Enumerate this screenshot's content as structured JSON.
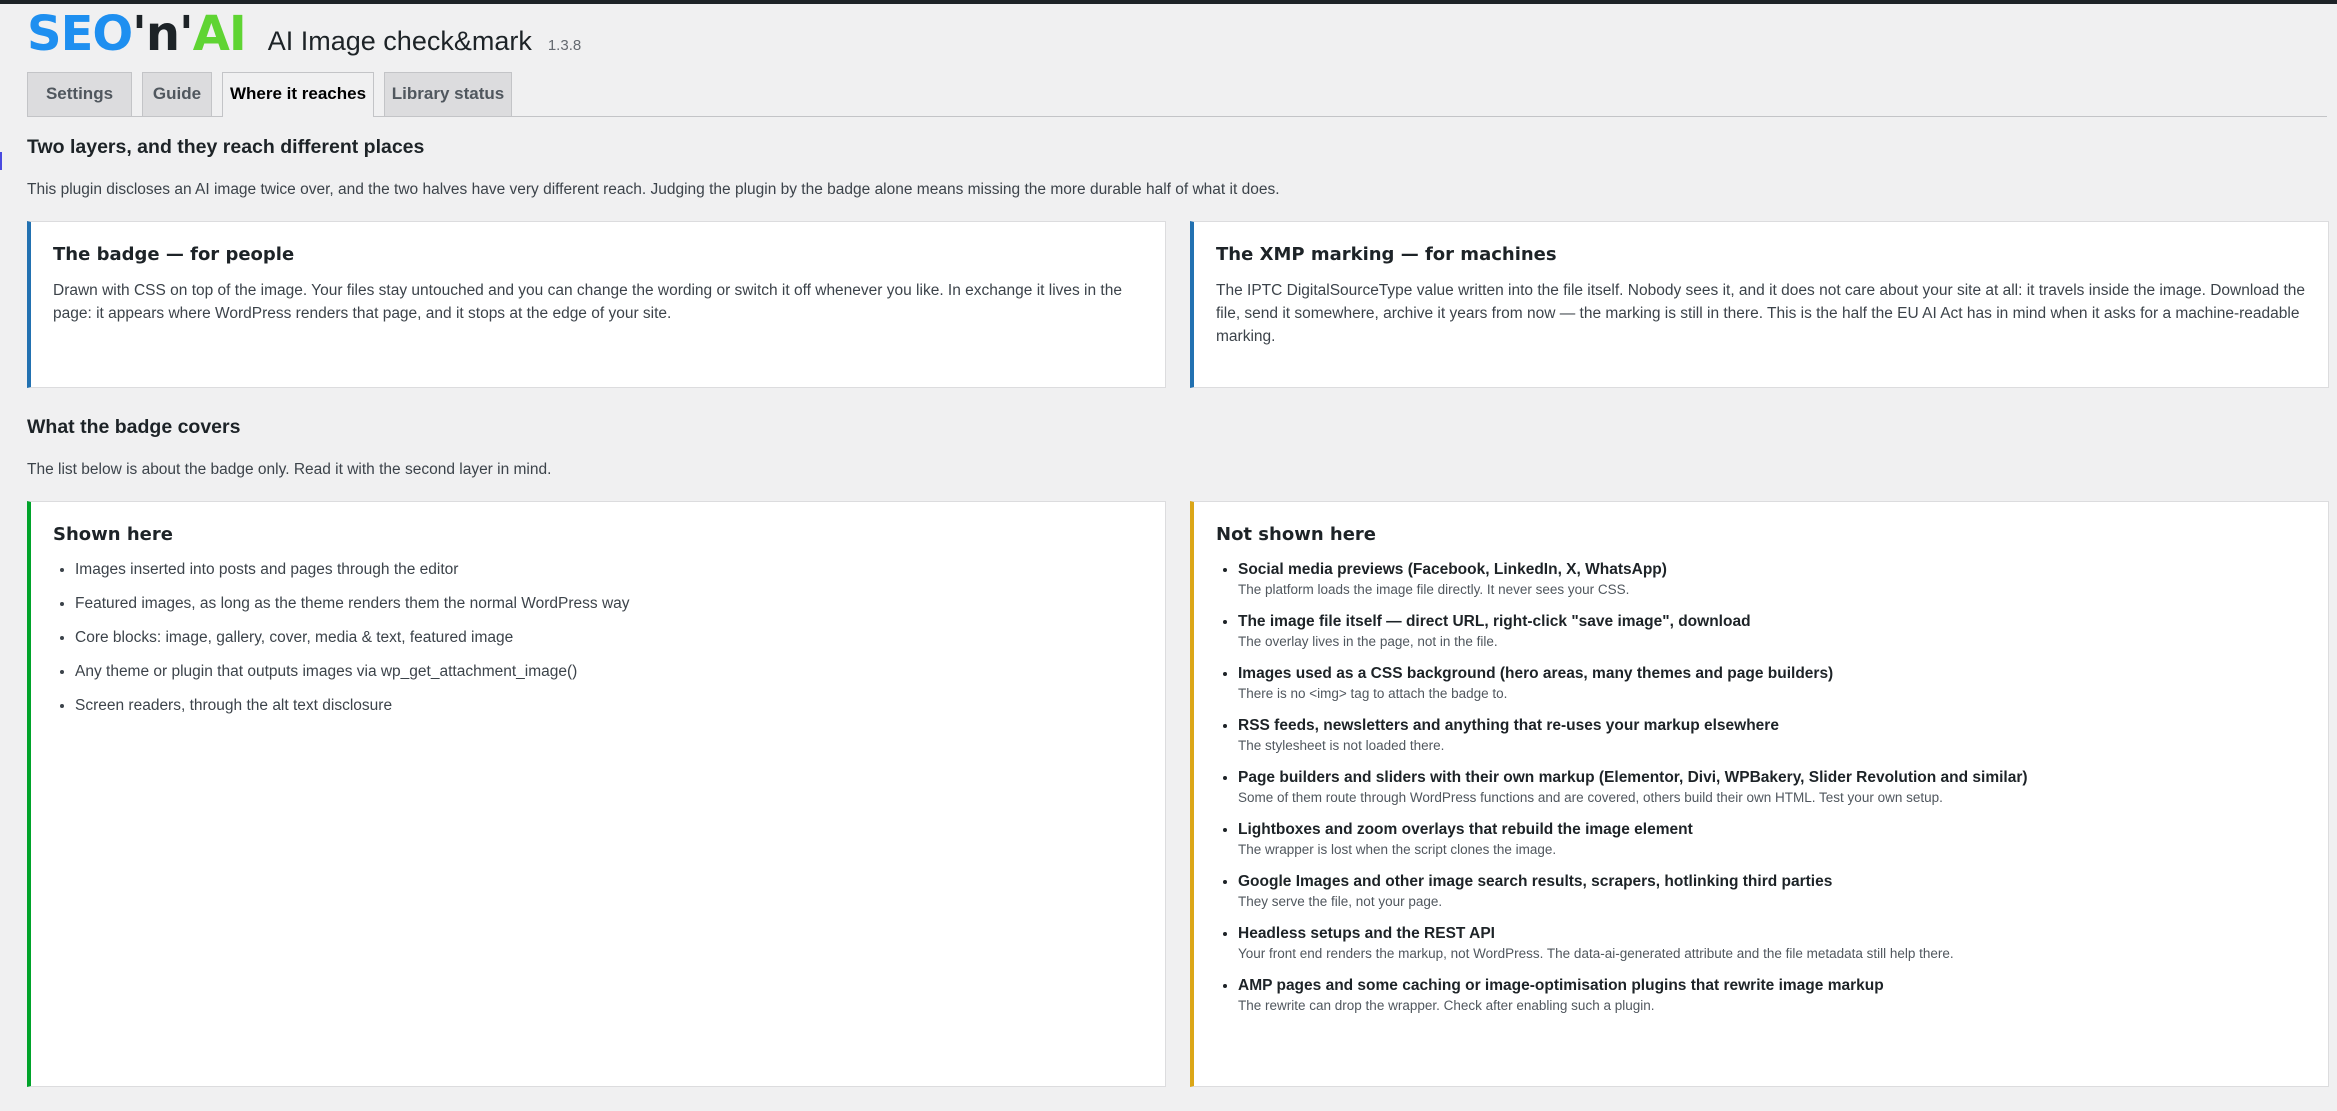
{
  "header": {
    "logo": {
      "seo": "SEO",
      "n": "'n'",
      "ai": "AI"
    },
    "title": "AI Image check&mark",
    "version": "1.3.8"
  },
  "tabs": [
    {
      "label": "Settings",
      "active": false
    },
    {
      "label": "Guide",
      "active": false
    },
    {
      "label": "Where it reaches",
      "active": true
    },
    {
      "label": "Library status",
      "active": false
    }
  ],
  "section1": {
    "title": "Two layers, and they reach different places",
    "intro": "This plugin discloses an AI image twice over, and the two halves have very different reach. Judging the plugin by the badge alone means missing the more durable half of what it does.",
    "badge_card": {
      "title": "The badge — for people",
      "text": "Drawn with CSS on top of the image. Your files stay untouched and you can change the wording or switch it off whenever you like. In exchange it lives in the page: it appears where WordPress renders that page, and it stops at the edge of your site."
    },
    "xmp_card": {
      "title": "The XMP marking — for machines",
      "text": "The IPTC DigitalSourceType value written into the file itself. Nobody sees it, and it does not care about your site at all: it travels inside the image. Download the file, send it somewhere, archive it years from now — the marking is still in there. This is the half the EU AI Act has in mind when it asks for a machine-readable marking."
    }
  },
  "section2": {
    "title": "What the badge covers",
    "intro": "The list below is about the badge only. Read it with the second layer in mind.",
    "shown": {
      "title": "Shown here",
      "items": [
        "Images inserted into posts and pages through the editor",
        "Featured images, as long as the theme renders them the normal WordPress way",
        "Core blocks: image, gallery, cover, media & text, featured image",
        "Any theme or plugin that outputs images via wp_get_attachment_image()",
        "Screen readers, through the alt text disclosure"
      ]
    },
    "not_shown": {
      "title": "Not shown here",
      "items": [
        {
          "title": "Social media previews (Facebook, LinkedIn, X, WhatsApp)",
          "desc": "The platform loads the image file directly. It never sees your CSS."
        },
        {
          "title": "The image file itself — direct URL, right-click \"save image\", download",
          "desc": "The overlay lives in the page, not in the file."
        },
        {
          "title": "Images used as a CSS background (hero areas, many themes and page builders)",
          "desc": "There is no <img> tag to attach the badge to."
        },
        {
          "title": "RSS feeds, newsletters and anything that re-uses your markup elsewhere",
          "desc": "The stylesheet is not loaded there."
        },
        {
          "title": "Page builders and sliders with their own markup (Elementor, Divi, WPBakery, Slider Revolution and similar)",
          "desc": "Some of them route through WordPress functions and are covered, others build their own HTML. Test your own setup."
        },
        {
          "title": "Lightboxes and zoom overlays that rebuild the image element",
          "desc": "The wrapper is lost when the script clones the image."
        },
        {
          "title": "Google Images and other image search results, scrapers, hotlinking third parties",
          "desc": "They serve the file, not your page."
        },
        {
          "title": "Headless setups and the REST API",
          "desc": "Your front end renders the markup, not WordPress. The data-ai-generated attribute and the file metadata still help there."
        },
        {
          "title": "AMP pages and some caching or image-optimisation plugins that rewrite image markup",
          "desc": "The rewrite can drop the wrapper. Check after enabling such a plugin."
        }
      ]
    }
  }
}
